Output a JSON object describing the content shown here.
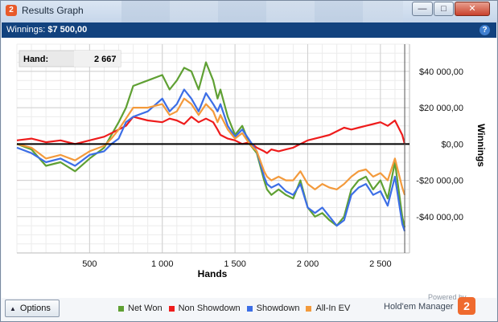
{
  "window": {
    "title": "Results Graph",
    "app_icon": "hold-em-manager-icon",
    "controls": {
      "minimize": "—",
      "maximize": "□",
      "close": "✕"
    }
  },
  "header": {
    "winnings_label": "Winnings:",
    "winnings_value": "$7 500,00",
    "help": "?"
  },
  "tooltip": {
    "label": "Hand:",
    "value": "2 667"
  },
  "footer": {
    "options_label": "Options",
    "powered_by": "Powered by",
    "brand": "Hold'em Manager",
    "brand_logo": "2",
    "legend": [
      {
        "name": "Net Won",
        "color": "#5fa033"
      },
      {
        "name": "Non Showdown",
        "color": "#ee1c1c"
      },
      {
        "name": "Showdown",
        "color": "#3c6ee6"
      },
      {
        "name": "All-In EV",
        "color": "#f39a3c"
      }
    ]
  },
  "chart_data": {
    "type": "line",
    "xlabel": "Hands",
    "ylabel": "Winnings",
    "xlim": [
      0,
      2700
    ],
    "ylim": [
      -60000,
      55000
    ],
    "x_ticks": [
      500,
      1000,
      1500,
      2000,
      2500
    ],
    "x_tick_labels": [
      "500",
      "1 000",
      "1 500",
      "2 000",
      "2 500"
    ],
    "y_ticks": [
      40000,
      20000,
      0,
      -20000,
      -40000
    ],
    "y_tick_labels": [
      "$40 000,00",
      "$20 000,00",
      "$0,00",
      "-$20 000,00",
      "-$40 000,00"
    ],
    "grid": true,
    "zero_line": true,
    "legend_position": "bottom",
    "cursor_x": 2667,
    "series": [
      {
        "name": "Net Won",
        "color": "#5fa033",
        "x": [
          0,
          100,
          200,
          300,
          400,
          500,
          600,
          650,
          700,
          750,
          800,
          900,
          1000,
          1050,
          1100,
          1150,
          1200,
          1250,
          1300,
          1350,
          1380,
          1400,
          1450,
          1500,
          1550,
          1600,
          1650,
          1700,
          1720,
          1750,
          1800,
          1850,
          1900,
          1950,
          2000,
          2050,
          2100,
          2150,
          2200,
          2250,
          2300,
          2350,
          2400,
          2450,
          2500,
          2550,
          2600,
          2650,
          2667
        ],
        "y": [
          0,
          -3000,
          -12000,
          -10000,
          -15000,
          -8000,
          -2000,
          5000,
          12000,
          20000,
          32000,
          35000,
          38000,
          30000,
          35000,
          42000,
          40000,
          30000,
          45000,
          35000,
          25000,
          30000,
          15000,
          5000,
          10000,
          0,
          -5000,
          -20000,
          -25000,
          -28000,
          -25000,
          -28000,
          -30000,
          -20000,
          -35000,
          -40000,
          -38000,
          -42000,
          -45000,
          -40000,
          -25000,
          -20000,
          -18000,
          -25000,
          -20000,
          -30000,
          -10000,
          -40000,
          -46000
        ]
      },
      {
        "name": "Non Showdown",
        "color": "#ee1c1c",
        "x": [
          0,
          100,
          200,
          300,
          400,
          500,
          600,
          650,
          700,
          750,
          800,
          900,
          1000,
          1050,
          1100,
          1150,
          1200,
          1250,
          1300,
          1350,
          1380,
          1400,
          1450,
          1500,
          1550,
          1600,
          1650,
          1700,
          1720,
          1750,
          1800,
          1850,
          1900,
          1950,
          2000,
          2050,
          2100,
          2150,
          2200,
          2250,
          2300,
          2350,
          2400,
          2450,
          2500,
          2550,
          2600,
          2650,
          2667
        ],
        "y": [
          2000,
          3000,
          1000,
          2000,
          0,
          2000,
          4000,
          6000,
          8000,
          10000,
          15000,
          13000,
          12000,
          14000,
          13000,
          11000,
          15000,
          12000,
          14000,
          12000,
          8000,
          5000,
          3000,
          2000,
          0,
          1000,
          -2000,
          -4000,
          -5000,
          -3000,
          -4000,
          -3000,
          -2000,
          0,
          2000,
          3000,
          4000,
          5000,
          7000,
          9000,
          8000,
          9000,
          10000,
          11000,
          12000,
          10000,
          13000,
          5000,
          0
        ]
      },
      {
        "name": "Showdown",
        "color": "#3c6ee6",
        "x": [
          0,
          100,
          200,
          300,
          400,
          500,
          600,
          650,
          700,
          750,
          800,
          900,
          1000,
          1050,
          1100,
          1150,
          1200,
          1250,
          1300,
          1350,
          1380,
          1400,
          1450,
          1500,
          1550,
          1600,
          1650,
          1700,
          1720,
          1750,
          1800,
          1850,
          1900,
          1950,
          2000,
          2050,
          2100,
          2150,
          2200,
          2250,
          2300,
          2350,
          2400,
          2450,
          2500,
          2550,
          2600,
          2650,
          2667
        ],
        "y": [
          -2000,
          -5000,
          -10000,
          -8000,
          -12000,
          -6000,
          -4000,
          0,
          3000,
          12000,
          15000,
          18000,
          25000,
          18000,
          22000,
          30000,
          25000,
          18000,
          28000,
          22000,
          18000,
          22000,
          10000,
          4000,
          8000,
          2000,
          -4000,
          -18000,
          -22000,
          -24000,
          -22000,
          -26000,
          -28000,
          -22000,
          -35000,
          -38000,
          -35000,
          -40000,
          -45000,
          -42000,
          -28000,
          -24000,
          -22000,
          -28000,
          -26000,
          -34000,
          -18000,
          -44000,
          -48000
        ]
      },
      {
        "name": "All-In EV",
        "color": "#f39a3c",
        "x": [
          0,
          100,
          200,
          300,
          400,
          500,
          600,
          650,
          700,
          750,
          800,
          900,
          1000,
          1050,
          1100,
          1150,
          1200,
          1250,
          1300,
          1350,
          1380,
          1400,
          1450,
          1500,
          1550,
          1600,
          1650,
          1700,
          1720,
          1750,
          1800,
          1850,
          1900,
          1950,
          2000,
          2050,
          2100,
          2150,
          2200,
          2250,
          2300,
          2350,
          2400,
          2450,
          2500,
          2550,
          2600,
          2650,
          2667
        ],
        "y": [
          0,
          -2000,
          -8000,
          -6000,
          -9000,
          -4000,
          -1000,
          3000,
          8000,
          14000,
          20000,
          20000,
          22000,
          16000,
          18000,
          25000,
          22000,
          16000,
          22000,
          18000,
          12000,
          16000,
          8000,
          3000,
          6000,
          0,
          -4000,
          -15000,
          -18000,
          -20000,
          -18000,
          -20000,
          -20000,
          -15000,
          -22000,
          -25000,
          -22000,
          -24000,
          -25000,
          -22000,
          -18000,
          -15000,
          -14000,
          -18000,
          -16000,
          -20000,
          -8000,
          -24000,
          -28000
        ]
      }
    ]
  }
}
